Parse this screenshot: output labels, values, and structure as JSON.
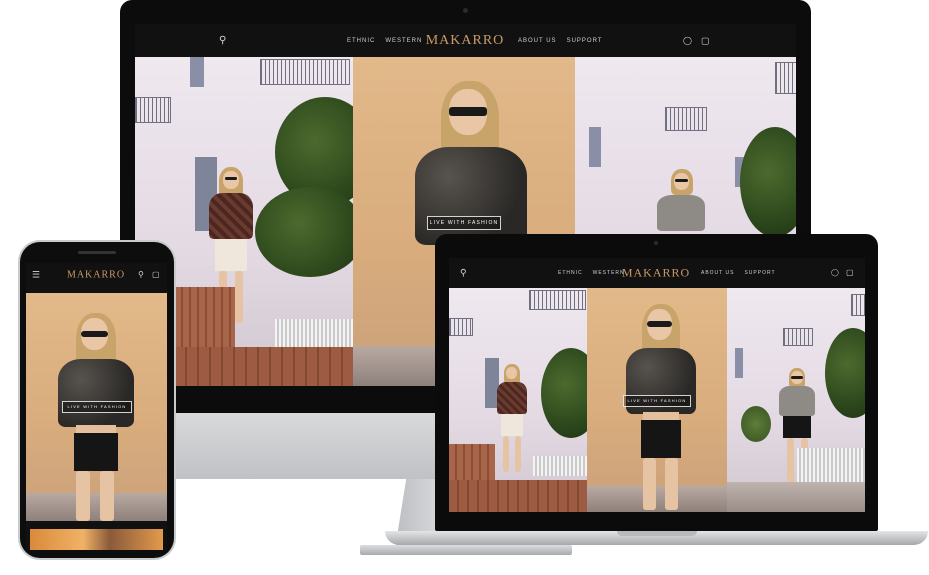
{
  "brand": {
    "logo": "MAKARRO",
    "accent_color": "#c99a66",
    "nav_background": "#111111"
  },
  "nav": {
    "left_menu": [
      "ETHNIC",
      "WESTERN"
    ],
    "right_menu": [
      "ABOUT US",
      "SUPPORT"
    ],
    "icons": [
      "search-icon",
      "account-icon",
      "cart-icon",
      "menu-icon"
    ]
  },
  "hero": {
    "tagline": "LIVE WITH FASHION"
  }
}
